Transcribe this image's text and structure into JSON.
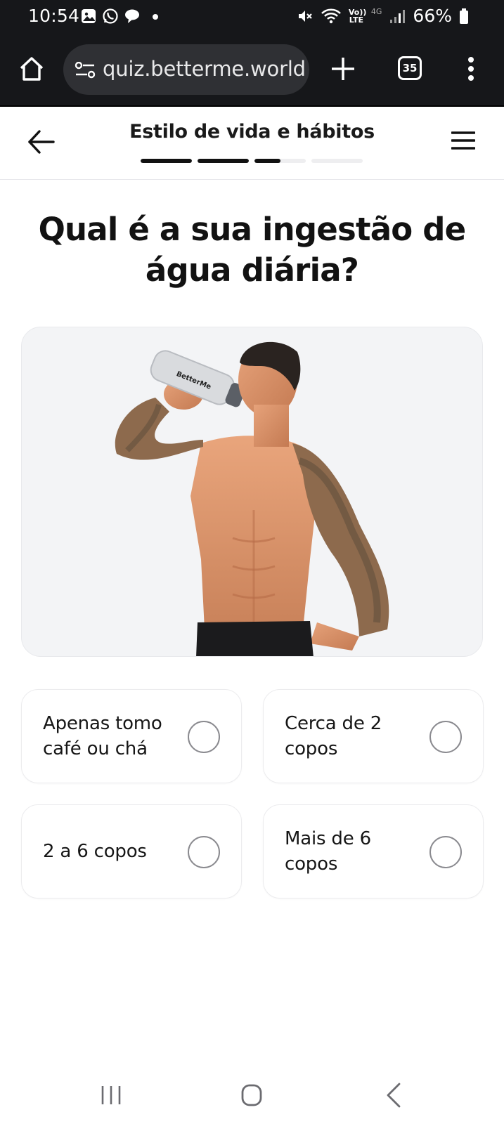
{
  "status_bar": {
    "time": "10:54",
    "battery": "66%",
    "network_label": "4G",
    "volte_label": "Vo)) LTE",
    "icons": [
      "gallery-icon",
      "whatsapp-icon",
      "chat-bubble-icon",
      "notification-dot-icon",
      "mute-icon",
      "wifi-icon",
      "volte-icon",
      "signal-icon",
      "battery-icon"
    ]
  },
  "browser": {
    "url": "quiz.betterme.world",
    "tab_count": "35",
    "icons": [
      "home-icon",
      "site-settings-icon",
      "plus-icon",
      "tabs-icon",
      "more-vert-icon"
    ]
  },
  "quiz_header": {
    "title": "Estilo de vida e hábitos",
    "progress": [
      1,
      1,
      0.5,
      0
    ],
    "icons": [
      "arrow-left-icon",
      "hamburger-menu-icon"
    ]
  },
  "question": {
    "text": "Qual é a sua ingestão de água diária?"
  },
  "hero_image": {
    "bottle_text": "BetterMe"
  },
  "options": [
    {
      "label": "Apenas tomo café ou chá",
      "selected": false
    },
    {
      "label": "Cerca de 2 copos",
      "selected": false
    },
    {
      "label": "2 a 6 copos",
      "selected": false
    },
    {
      "label": "Mais de 6 copos",
      "selected": false
    }
  ],
  "nav_bar": {
    "icons": [
      "recent-apps-icon",
      "home-icon",
      "back-icon"
    ]
  },
  "colors": {
    "status_bar_bg": "#16171a",
    "url_pill_bg": "#2f3034",
    "progress_active": "#111111",
    "progress_inactive": "#eeeef0",
    "hero_bg": "#f3f4f6"
  }
}
